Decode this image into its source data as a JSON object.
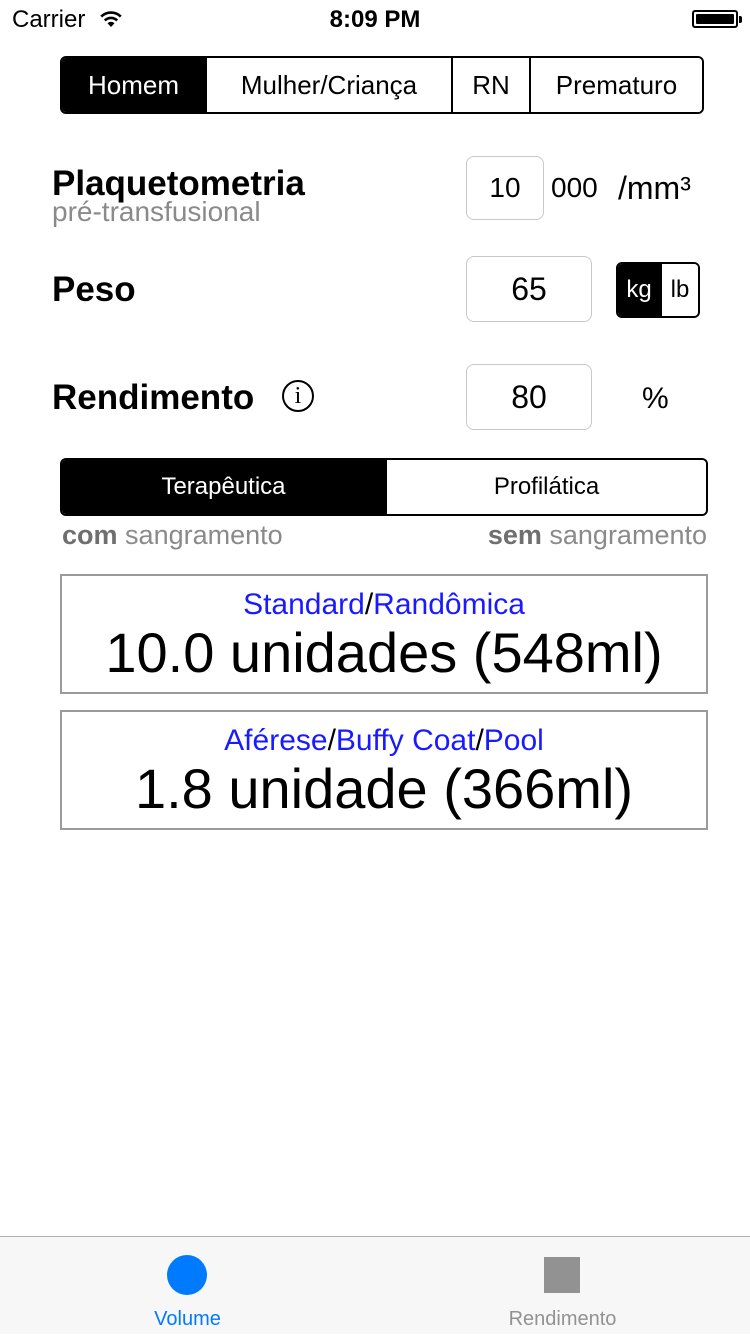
{
  "status_bar": {
    "carrier": "Carrier",
    "time": "8:09 PM"
  },
  "patient_type": {
    "options": [
      "Homem",
      "Mulher/Criança",
      "RN",
      "Prematuro"
    ],
    "selected": "Homem"
  },
  "platelet": {
    "title": "Plaquetometria",
    "subtitle": "pré-transfusional",
    "value": "10",
    "multiplier": "000",
    "unit": "/mm³"
  },
  "weight": {
    "title": "Peso",
    "value": "65",
    "units": [
      "kg",
      "lb"
    ],
    "selected_unit": "kg"
  },
  "yield": {
    "title": "Rendimento",
    "value": "80",
    "unit": "%"
  },
  "therapy": {
    "options": [
      "Terapêutica",
      "Profilática"
    ],
    "selected": "Terapêutica",
    "left_hint_bold": "com",
    "left_hint": "sangramento",
    "right_hint_bold": "sem",
    "right_hint": "sangramento"
  },
  "results": [
    {
      "types": [
        "Standard",
        "Randômica"
      ],
      "value": "10.0 unidades (548ml)"
    },
    {
      "types": [
        "Aférese",
        "Buffy Coat",
        "Pool"
      ],
      "value": "1.8 unidade (366ml)"
    }
  ],
  "tabs": [
    {
      "label": "Volume",
      "icon": "circle-icon",
      "active": true
    },
    {
      "label": "Rendimento",
      "icon": "square-icon",
      "active": false
    }
  ],
  "colors": {
    "accent": "#007aff",
    "link": "#1a1aff",
    "inactive": "#929292"
  }
}
